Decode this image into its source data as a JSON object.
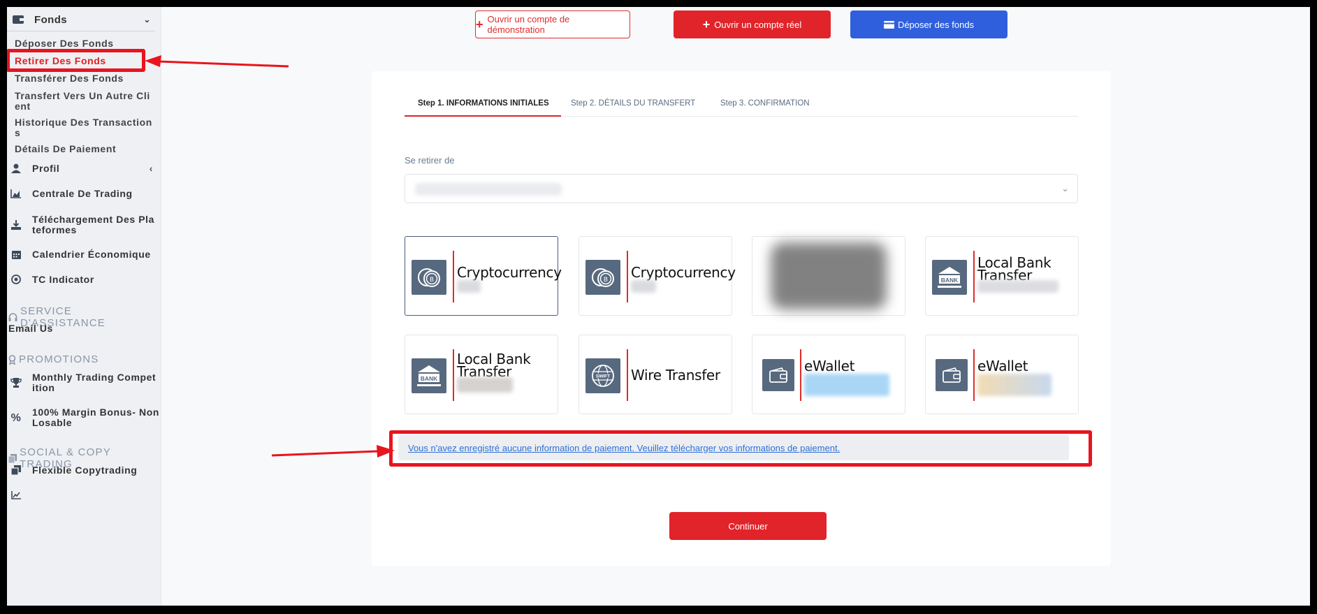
{
  "sidebar": {
    "fonds": {
      "label": "Fonds",
      "chevron": "chevron-down-icon"
    },
    "fonds_items": [
      {
        "label": "Déposer Des Fonds"
      },
      {
        "label": "Retirer Des Fonds"
      },
      {
        "label": "Transférer Des Fonds"
      },
      {
        "label": "Transfert Vers Un Autre Client"
      },
      {
        "label": "Historique Des Transactions"
      },
      {
        "label": "Détails De Paiement"
      }
    ],
    "items": [
      {
        "label": "Profil",
        "icon": "user-icon"
      },
      {
        "label": "Centrale De Trading",
        "icon": "chart-area-icon"
      },
      {
        "label": "Téléchargement Des Plateformes",
        "icon": "download-icon"
      },
      {
        "label": "Calendrier Économique",
        "icon": "calendar-icon"
      },
      {
        "label": "TC Indicator",
        "icon": "target-icon"
      }
    ],
    "service": {
      "title": "SERVICE D'ASSISTANCE",
      "email": "Email Us"
    },
    "promotions": {
      "title": "PROMOTIONS",
      "items": [
        {
          "label": "Monthly Trading Competition",
          "icon": "trophy-icon"
        },
        {
          "label": "100% Margin Bonus- Non Losable",
          "icon": "percent-icon"
        }
      ]
    },
    "social": {
      "title": "SOCIAL & COPY TRADING",
      "items": [
        {
          "label": "Flexible Copytrading",
          "icon": "copy-icon"
        }
      ]
    }
  },
  "top_buttons": {
    "demo": "Ouvrir un compte de démonstration",
    "real": "Ouvrir un compte réel",
    "deposit": "Déposer des fonds"
  },
  "tabs": [
    {
      "label": "Step 1. INFORMATIONS INITIALES",
      "active": true
    },
    {
      "label": "Step 2. DÉTAILS DU TRANSFERT",
      "active": false
    },
    {
      "label": "Step 3. CONFIRMATION",
      "active": false
    }
  ],
  "form": {
    "source_label": "Se retirer de"
  },
  "payment_methods": [
    {
      "name": "Cryptocurrency",
      "icon": "crypto-coins-icon",
      "selected": true
    },
    {
      "name": "Cryptocurrency",
      "icon": "crypto-coins-icon",
      "selected": false
    },
    {
      "name": "",
      "icon": "blurred-logo",
      "selected": false
    },
    {
      "name": "Local Bank Transfer",
      "icon": "bank-icon",
      "selected": false
    },
    {
      "name": "Local Bank Transfer",
      "icon": "bank-icon",
      "selected": false
    },
    {
      "name": "Wire Transfer",
      "icon": "swift-globe-icon",
      "selected": false
    },
    {
      "name": "eWallet",
      "icon": "wallet-icon",
      "selected": false
    },
    {
      "name": "eWallet",
      "icon": "wallet-icon",
      "selected": false
    }
  ],
  "notice": "Vous n'avez enregistré aucune information de paiement. Veuillez télécharger vos informations de paiement.",
  "continue_label": "Continuer",
  "colors": {
    "accent_red": "#e0242a",
    "annotation_red": "#e8141e",
    "deposit_blue": "#2f5fdc",
    "logo_slate": "#57697f"
  }
}
